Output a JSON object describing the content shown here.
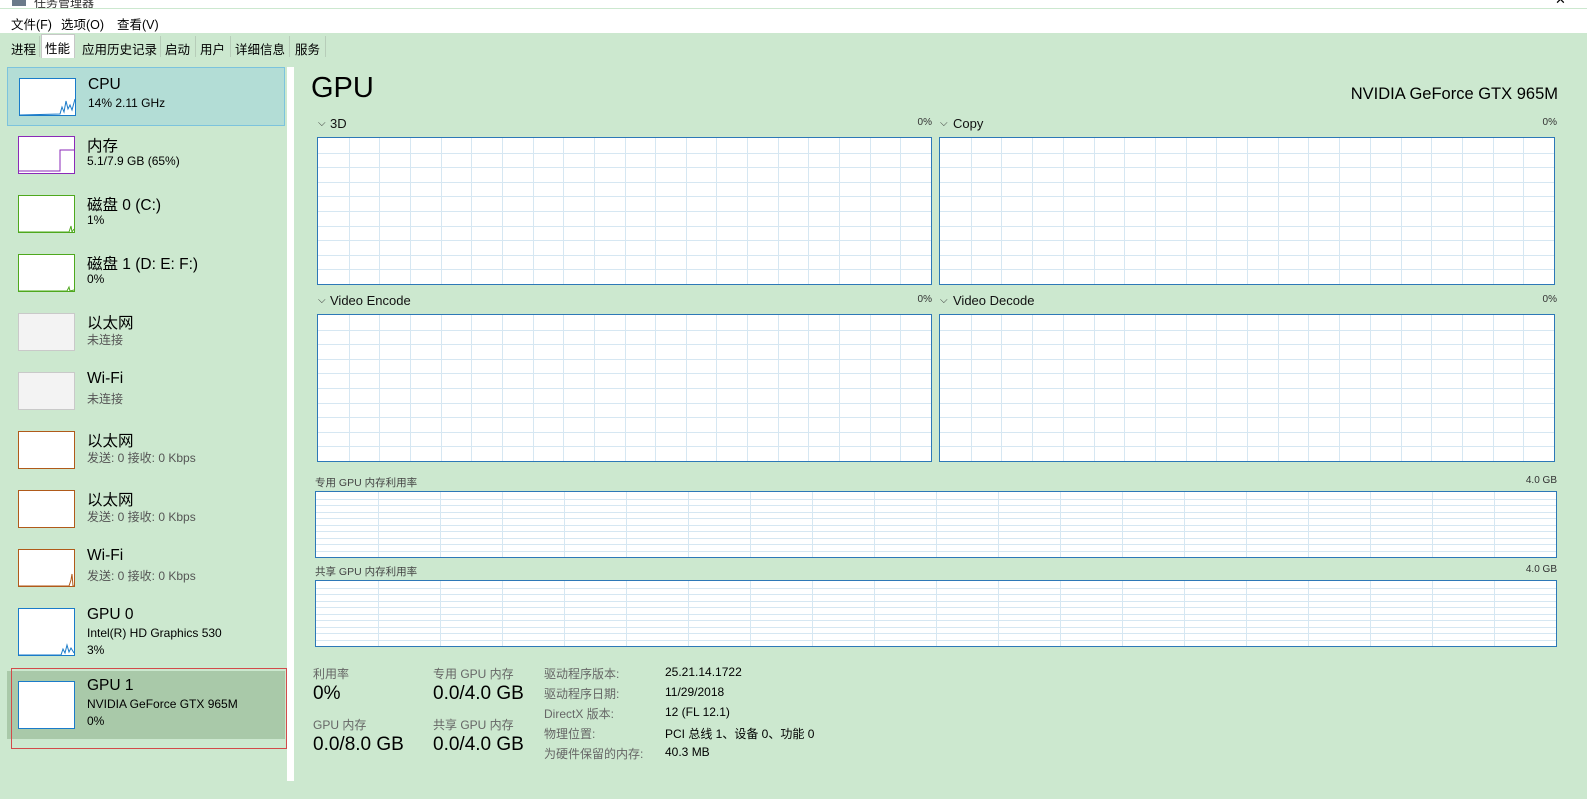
{
  "window": {
    "title": "任务管理器"
  },
  "menu": {
    "file": "文件(F)",
    "options": "选项(O)",
    "view": "查看(V)"
  },
  "tabs": [
    "进程",
    "性能",
    "应用历史记录",
    "启动",
    "用户",
    "详细信息",
    "服务"
  ],
  "sidebar": {
    "items": [
      {
        "name": "CPU",
        "sub": "14% 2.11 GHz",
        "sub2": "",
        "color": "#1a7bc9"
      },
      {
        "name": "内存",
        "sub": "5.1/7.9 GB (65%)",
        "sub2": "",
        "color": "#8b2ab8"
      },
      {
        "name": "磁盘 0 (C:)",
        "sub": "1%",
        "sub2": "",
        "color": "#4ea81d"
      },
      {
        "name": "磁盘 1 (D: E: F:)",
        "sub": "0%",
        "sub2": "",
        "color": "#4ea81d"
      },
      {
        "name": "以太网",
        "sub": "未连接",
        "sub2": "",
        "color": "#c9c9c9"
      },
      {
        "name": "Wi-Fi",
        "sub": "未连接",
        "sub2": "",
        "color": "#c9c9c9"
      },
      {
        "name": "以太网",
        "sub": "发送: 0 接收: 0 Kbps",
        "sub2": "",
        "color": "#b05a1a"
      },
      {
        "name": "以太网",
        "sub": "发送: 0 接收: 0 Kbps",
        "sub2": "",
        "color": "#b05a1a"
      },
      {
        "name": "Wi-Fi",
        "sub": "发送: 0 接收: 0 Kbps",
        "sub2": "",
        "color": "#b05a1a"
      },
      {
        "name": "GPU 0",
        "sub": "Intel(R) HD Graphics 530",
        "sub2": "3%",
        "color": "#1a7bc9"
      },
      {
        "name": "GPU 1",
        "sub": "NVIDIA GeForce GTX 965M",
        "sub2": "0%",
        "color": "#1a7bc9"
      }
    ]
  },
  "main": {
    "title": "GPU",
    "device": "NVIDIA GeForce GTX 965M",
    "engines": [
      {
        "label": "3D",
        "pct": "0%"
      },
      {
        "label": "Copy",
        "pct": "0%"
      },
      {
        "label": "Video Encode",
        "pct": "0%"
      },
      {
        "label": "Video Decode",
        "pct": "0%"
      }
    ],
    "dedicated_mem": {
      "label": "专用 GPU 内存利用率",
      "max": "4.0 GB"
    },
    "shared_mem": {
      "label": "共享 GPU 内存利用率",
      "max": "4.0 GB"
    },
    "stats": {
      "utilization": {
        "label": "利用率",
        "value": "0%"
      },
      "dedicated": {
        "label": "专用 GPU 内存",
        "value": "0.0/4.0 GB"
      },
      "gpu_mem": {
        "label": "GPU 内存",
        "value": "0.0/8.0 GB"
      },
      "shared": {
        "label": "共享 GPU 内存",
        "value": "0.0/4.0 GB"
      }
    },
    "details": [
      {
        "key": "驱动程序版本:",
        "value": "25.21.14.1722"
      },
      {
        "key": "驱动程序日期:",
        "value": "11/29/2018"
      },
      {
        "key": "DirectX 版本:",
        "value": "12 (FL 12.1)"
      },
      {
        "key": "物理位置:",
        "value": "PCI 总线 1、设备 0、功能 0"
      },
      {
        "key": "为硬件保留的内存:",
        "value": "40.3 MB"
      }
    ]
  },
  "colors": {
    "background": "#cce8cf",
    "graph_border": "#2d78b7",
    "grid": "#d6e7f2",
    "selection": "#b3ddd6",
    "highlight": "#d24a4a"
  }
}
